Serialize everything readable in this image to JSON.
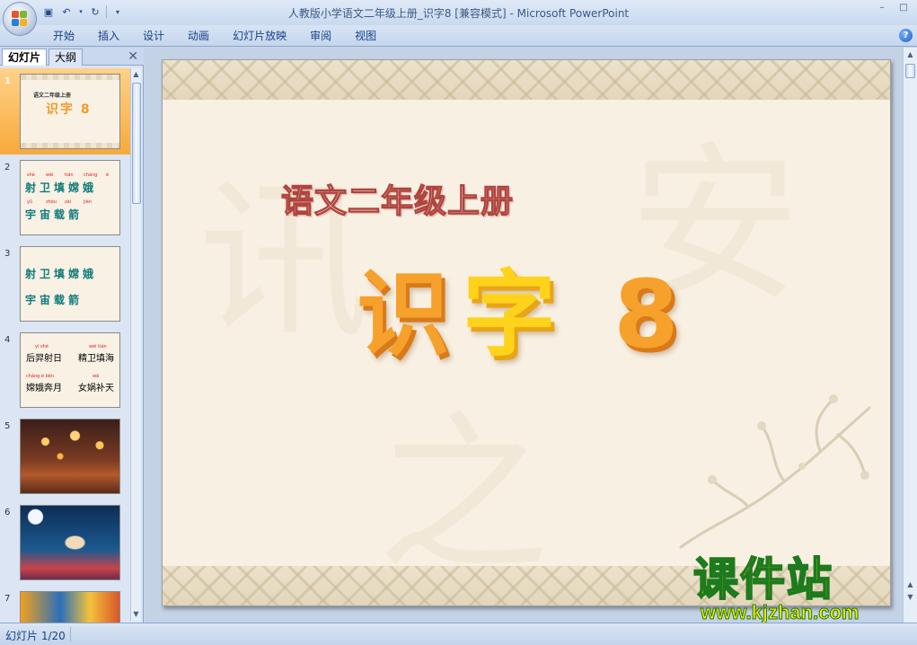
{
  "window": {
    "title": "人教版小学语文二年级上册_识字8 [兼容模式] - Microsoft PowerPoint",
    "controls": [
      "–",
      "□"
    ]
  },
  "ribbon": {
    "tabs": [
      "开始",
      "插入",
      "设计",
      "动画",
      "幻灯片放映",
      "审阅",
      "视图"
    ],
    "help": "?"
  },
  "slides_panel": {
    "tabs": [
      "幻灯片",
      "大纲"
    ],
    "close": "✕",
    "slide_numbers": [
      "1",
      "2",
      "3",
      "4",
      "5",
      "6",
      "7"
    ],
    "thumb1": {
      "subtitle": "语文二年级上册",
      "title": "识字 8"
    },
    "thumb2": {
      "pinyin_row1": [
        "shè",
        "wèi",
        "tián",
        "cháng",
        "é"
      ],
      "row1": "射卫填嫦娥",
      "pinyin_row2": [
        "yǔ",
        "zhòu",
        "zài",
        "jiàn"
      ],
      "row2": "宇宙载箭"
    },
    "thumb3": {
      "row1": "射卫填嫦娥",
      "row2": "宇宙载箭"
    },
    "thumb4": {
      "py1": "yì shè",
      "w1": "后羿射日",
      "py2": "wèi tián",
      "w2": "精卫填海",
      "py3": "cháng é bēn",
      "w3": "嫦娥奔月",
      "py4": "wā",
      "w4": "女娲补天"
    }
  },
  "slide": {
    "subtitle": "语文二年级上册",
    "title_part1": "识",
    "title_part2": "字",
    "title_part3": "8"
  },
  "brand": {
    "name": "课件站",
    "url": "www.kjzhan.com"
  },
  "status_bar": {
    "slide_position": "幻灯片 1/20"
  },
  "colors": {
    "title_orange": "#f6a12c",
    "title_yellow": "#ffd21c",
    "subtitle_stroke": "#b0443e",
    "slide_bg": "#f8f0e2",
    "selected_thumb": "#f7a93c"
  }
}
